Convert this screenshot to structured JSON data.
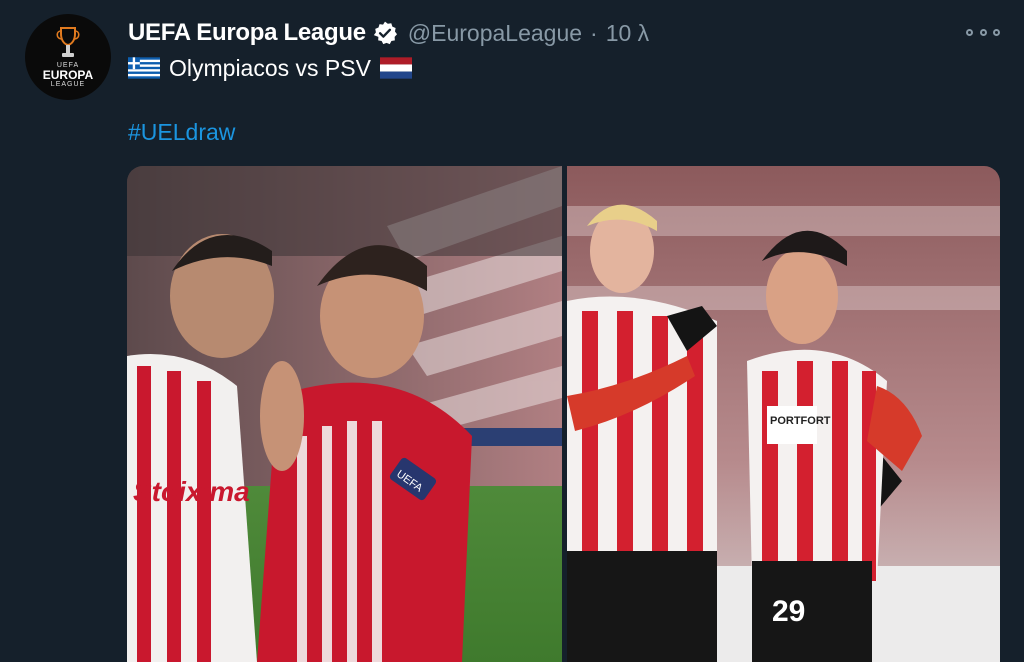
{
  "tweet": {
    "author_name": "UEFA Europa League",
    "handle": "@EuropaLeague",
    "separator": "·",
    "time": "10 λ",
    "text": "Olympiacos vs PSV",
    "hashtag": "#UELdraw"
  },
  "avatar": {
    "logo_top": "UEFA",
    "logo_main": "EUROPA",
    "logo_bottom": "LEAGUE"
  },
  "icons": {
    "verified": "verified-badge-icon",
    "more": "more-options-icon",
    "flag_left": "greece-flag-icon",
    "flag_right": "netherlands-flag-icon"
  },
  "photos": {
    "left": {
      "shirt_sponsor": "Stoixima",
      "sleeve_patch": "UEFA"
    },
    "right": {
      "shirt_sponsor": "PORTFORT",
      "shirt_number": "29"
    }
  },
  "colors": {
    "background": "#15202b",
    "text_primary": "#ffffff",
    "text_secondary": "#8899a6",
    "link": "#1b95e0"
  }
}
